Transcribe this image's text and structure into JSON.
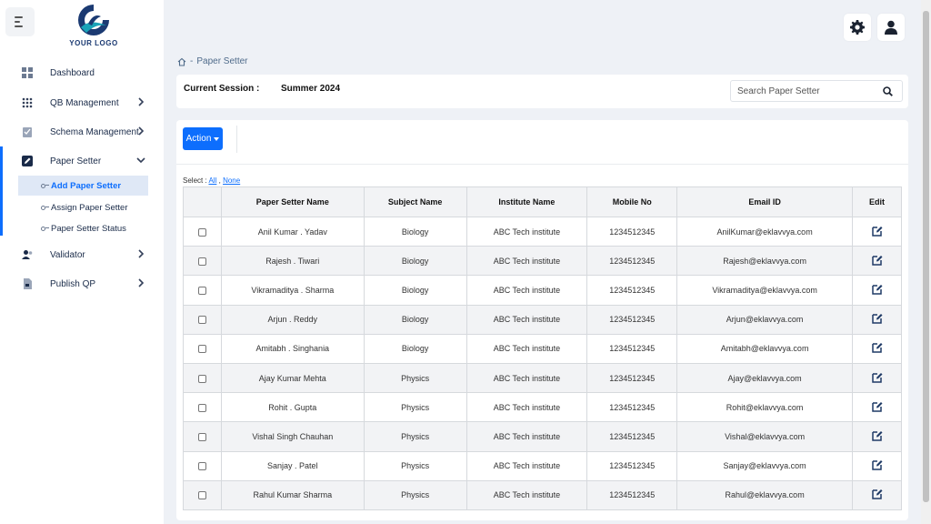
{
  "logo": {
    "text": "YOUR LOGO"
  },
  "sidebar": {
    "items": [
      {
        "label": "Dashboard",
        "icon": "dashboard-icon",
        "has_chevron": false
      },
      {
        "label": "QB Management",
        "icon": "grid-dots-icon",
        "has_chevron": true
      },
      {
        "label": "Schema Management",
        "icon": "clipboard-check-icon",
        "has_chevron": true
      },
      {
        "label": "Paper Setter",
        "icon": "pencil-icon",
        "has_chevron": true,
        "expanded": true
      },
      {
        "label": "Validator",
        "icon": "users-icon",
        "has_chevron": true
      },
      {
        "label": "Publish QP",
        "icon": "document-icon",
        "has_chevron": true
      }
    ],
    "sub_items": [
      {
        "label": "Add Paper Setter",
        "selected": true
      },
      {
        "label": "Assign Paper Setter",
        "selected": false
      },
      {
        "label": "Paper Setter Status",
        "selected": false
      }
    ]
  },
  "breadcrumb": {
    "separator": "-",
    "current": "Paper Setter"
  },
  "session": {
    "label": "Current Session :",
    "value": "Summer 2024"
  },
  "search": {
    "placeholder": "Search Paper Setter"
  },
  "toolbar": {
    "action_label": "Action"
  },
  "select": {
    "prefix": "Select :",
    "all": "All",
    "comma": ",",
    "none": "None"
  },
  "table": {
    "headers": [
      "",
      "Paper Setter Name",
      "Subject Name",
      "Institute Name",
      "Mobile No",
      "Email ID",
      "Edit"
    ],
    "rows": [
      [
        "Anil Kumar . Yadav",
        "Biology",
        "ABC Tech institute",
        "1234512345",
        "AnilKumar@eklavvya.com"
      ],
      [
        "Rajesh . Tiwari",
        "Biology",
        "ABC Tech institute",
        "1234512345",
        "Rajesh@eklavvya.com"
      ],
      [
        "Vikramaditya . Sharma",
        "Biology",
        "ABC Tech institute",
        "1234512345",
        "Vikramaditya@eklavvya.com"
      ],
      [
        "Arjun . Reddy",
        "Biology",
        "ABC Tech institute",
        "1234512345",
        "Arjun@eklavvya.com"
      ],
      [
        "Amitabh . Singhania",
        "Biology",
        "ABC Tech institute",
        "1234512345",
        "Amitabh@eklavvya.com"
      ],
      [
        "Ajay Kumar Mehta",
        "Physics",
        "ABC Tech institute",
        "1234512345",
        "Ajay@eklavvya.com"
      ],
      [
        "Rohit . Gupta",
        "Physics",
        "ABC Tech institute",
        "1234512345",
        "Rohit@eklavvya.com"
      ],
      [
        "Vishal Singh Chauhan",
        "Physics",
        "ABC Tech institute",
        "1234512345",
        "Vishal@eklavvya.com"
      ],
      [
        "Sanjay . Patel",
        "Physics",
        "ABC Tech institute",
        "1234512345",
        "Sanjay@eklavvya.com"
      ],
      [
        "Rahul Kumar Sharma",
        "Physics",
        "ABC Tech institute",
        "1234512345",
        "Rahul@eklavvya.com"
      ]
    ]
  },
  "colors": {
    "primary": "#0d6efd",
    "sidebar_text": "#1a2b49",
    "logo_dark": "#1b3a72",
    "logo_teal": "#1aa3b8",
    "background": "#eef1f6"
  }
}
